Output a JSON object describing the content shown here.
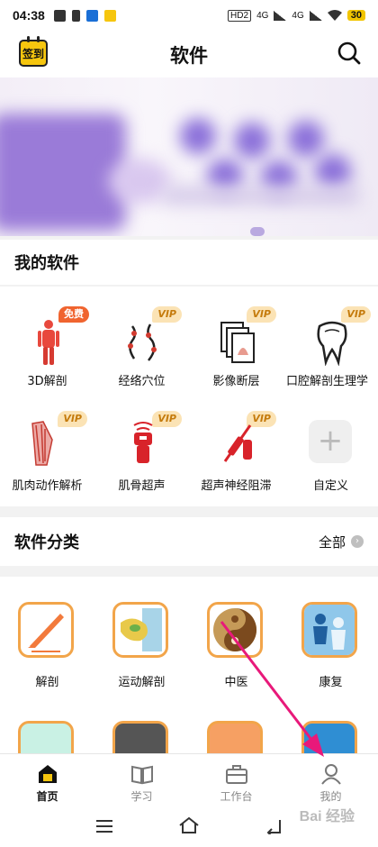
{
  "status": {
    "time": "04:38",
    "battery": "30",
    "network1": "4G",
    "network2": "4G",
    "hd": "HD2"
  },
  "header": {
    "title": "软件",
    "checkin_label": "签到"
  },
  "my_software": {
    "title": "我的软件",
    "items": [
      {
        "label": "3D解剖",
        "badge": "免费",
        "icon": "body-model-icon"
      },
      {
        "label": "经络穴位",
        "badge": "VIP",
        "icon": "meridian-icon"
      },
      {
        "label": "影像断层",
        "badge": "VIP",
        "icon": "imaging-slices-icon"
      },
      {
        "label": "口腔解剖生理学",
        "badge": "VIP",
        "icon": "tooth-icon"
      },
      {
        "label": "肌肉动作解析",
        "badge": "VIP",
        "icon": "muscle-icon"
      },
      {
        "label": "肌骨超声",
        "badge": "VIP",
        "icon": "ultrasound-probe-icon"
      },
      {
        "label": "超声神经阻滞",
        "badge": "VIP",
        "icon": "nerve-block-icon"
      },
      {
        "label": "自定义",
        "badge": "",
        "icon": "plus-icon"
      }
    ]
  },
  "categories": {
    "title": "软件分类",
    "all_label": "全部",
    "items": [
      {
        "label": "解剖",
        "icon": "scalpel-icon"
      },
      {
        "label": "运动解剖",
        "icon": "knee-joint-icon"
      },
      {
        "label": "中医",
        "icon": "taiji-icon"
      },
      {
        "label": "康复",
        "icon": "rehab-icon"
      }
    ]
  },
  "tabbar": {
    "items": [
      {
        "label": "首页",
        "icon": "home-icon",
        "active": true
      },
      {
        "label": "学习",
        "icon": "book-icon",
        "active": false
      },
      {
        "label": "工作台",
        "icon": "briefcase-icon",
        "active": false
      },
      {
        "label": "我的",
        "icon": "person-icon",
        "active": false
      }
    ]
  },
  "watermark": "Bai 经验",
  "colors": {
    "accent_yellow": "#f6c60e",
    "badge_vip_bg": "#fbe3b5",
    "badge_free_bg": "#f0642f",
    "tile_border": "#f2a54a",
    "annotation_arrow": "#e8197a"
  }
}
